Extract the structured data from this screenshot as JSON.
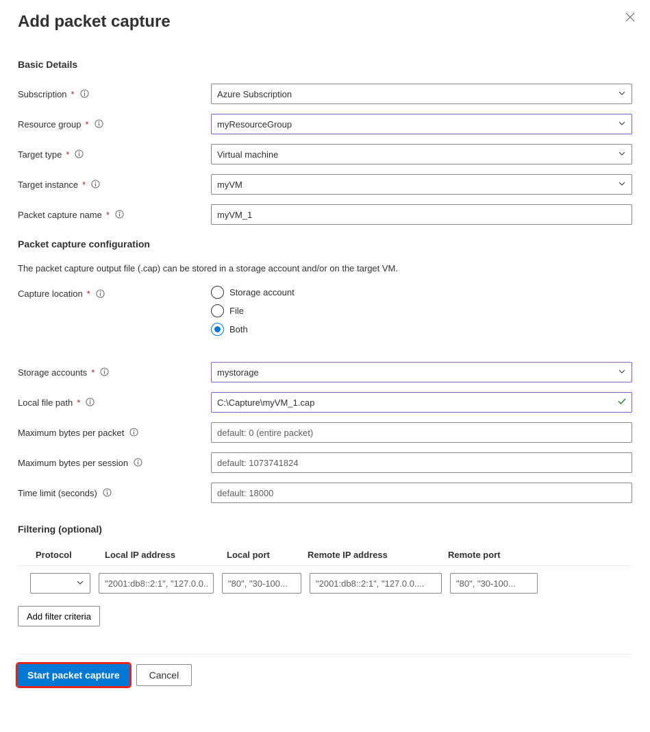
{
  "header": {
    "title": "Add packet capture"
  },
  "sections": {
    "basic": "Basic Details",
    "config": "Packet capture configuration",
    "filter": "Filtering (optional)"
  },
  "fields": {
    "subscription": {
      "label": "Subscription",
      "value": "Azure Subscription"
    },
    "resource_group": {
      "label": "Resource group",
      "value": "myResourceGroup"
    },
    "target_type": {
      "label": "Target type",
      "value": "Virtual machine"
    },
    "target_instance": {
      "label": "Target instance",
      "value": "myVM"
    },
    "capture_name": {
      "label": "Packet capture name",
      "value": "myVM_1"
    },
    "description": "The packet capture output file (.cap) can be stored in a storage account and/or on the target VM.",
    "capture_location": {
      "label": "Capture location",
      "options": {
        "storage": "Storage account",
        "file": "File",
        "both": "Both"
      },
      "selected": "both"
    },
    "storage_accounts": {
      "label": "Storage accounts",
      "value": "mystorage"
    },
    "local_path": {
      "label": "Local file path",
      "value": "C:\\Capture\\myVM_1.cap"
    },
    "max_bytes_packet": {
      "label": "Maximum bytes per packet",
      "placeholder": "default: 0 (entire packet)"
    },
    "max_bytes_session": {
      "label": "Maximum bytes per session",
      "placeholder": "default: 1073741824"
    },
    "time_limit": {
      "label": "Time limit (seconds)",
      "placeholder": "default: 18000"
    }
  },
  "filter": {
    "headers": {
      "protocol": "Protocol",
      "local_ip": "Local IP address",
      "local_port": "Local port",
      "remote_ip": "Remote IP address",
      "remote_port": "Remote port"
    },
    "placeholders": {
      "local_ip": "\"2001:db8::2:1\", \"127.0.0....",
      "local_port": "\"80\", \"30-100...",
      "remote_ip": "\"2001:db8::2:1\", \"127.0.0....",
      "remote_port": "\"80\", \"30-100..."
    },
    "add_button": "Add filter criteria"
  },
  "footer": {
    "start": "Start packet capture",
    "cancel": "Cancel"
  }
}
